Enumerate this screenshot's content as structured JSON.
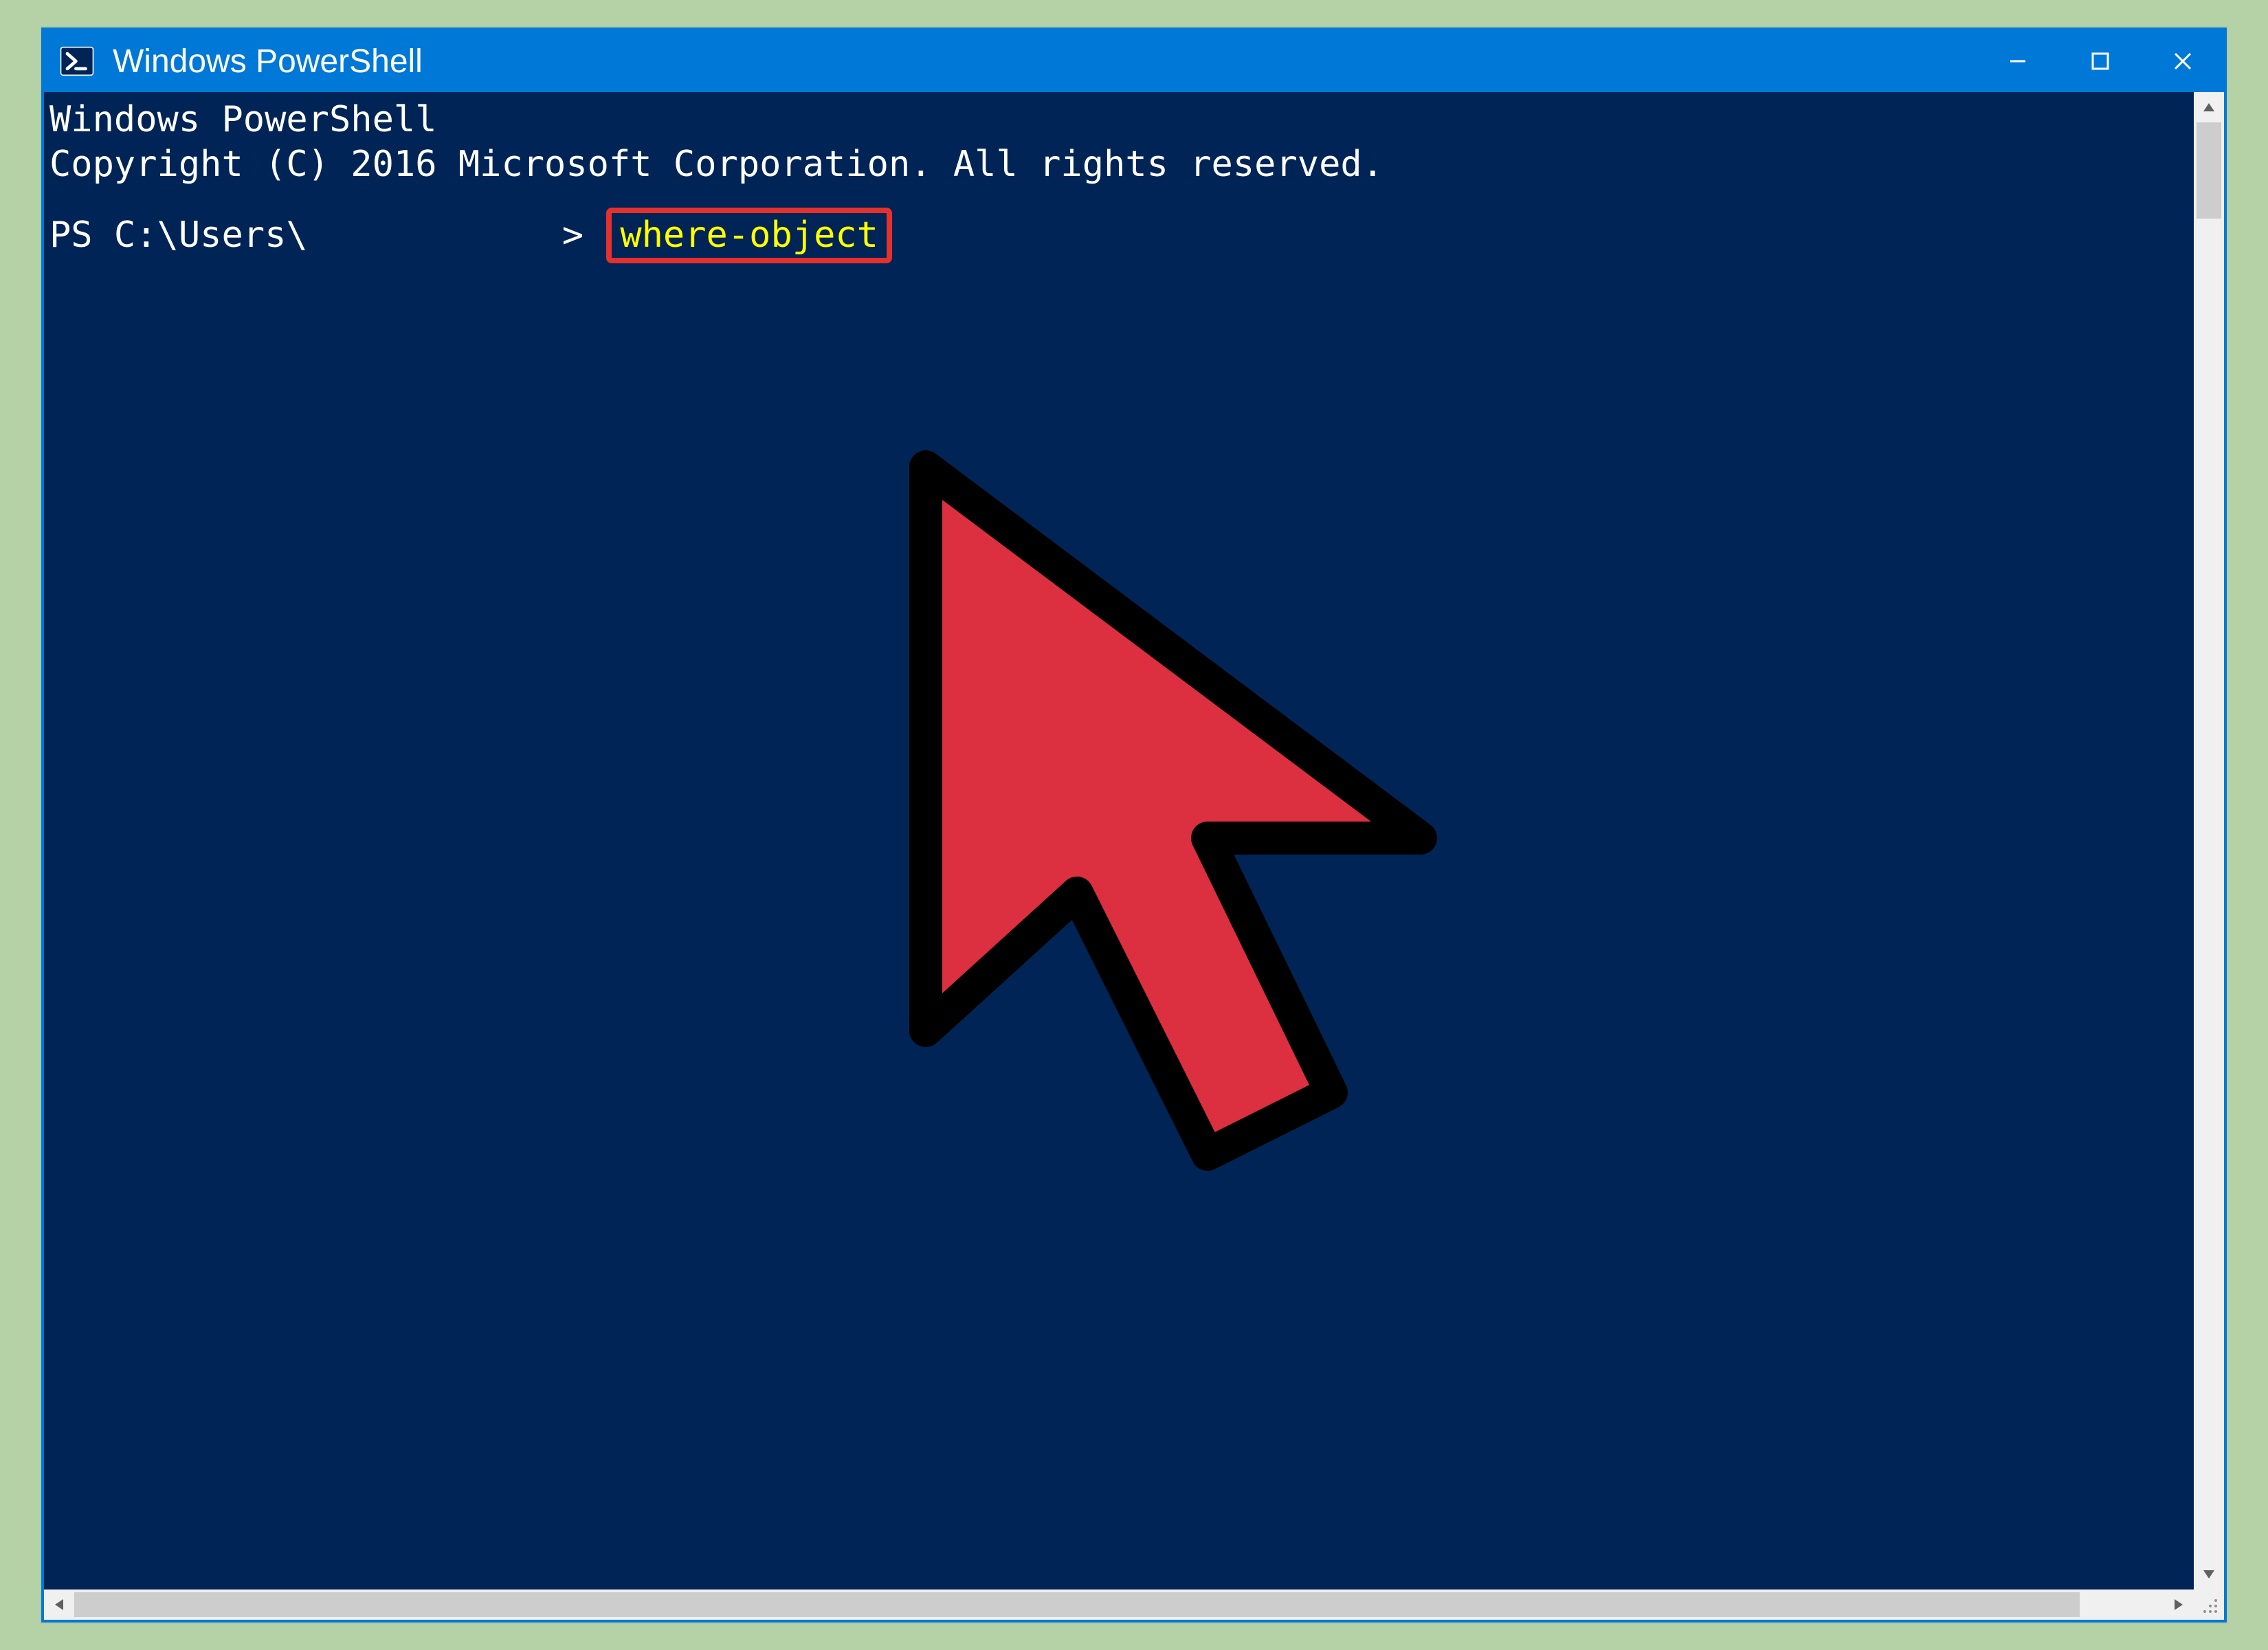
{
  "window": {
    "title": "Windows PowerShell"
  },
  "terminal": {
    "header_line1": "Windows PowerShell",
    "header_line2": "Copyright (C) 2016 Microsoft Corporation. All rights reserved.",
    "prompt_prefix": "PS C:\\Users\\",
    "prompt_suffix": ">",
    "highlighted_command": "where-object"
  },
  "colors": {
    "titlebar": "#0078d7",
    "terminal_bg": "#012456",
    "terminal_fg": "#ffffff",
    "command_fg": "#ffff00",
    "highlight_border": "#e4312d",
    "cursor_fill": "#dc2f3f"
  }
}
